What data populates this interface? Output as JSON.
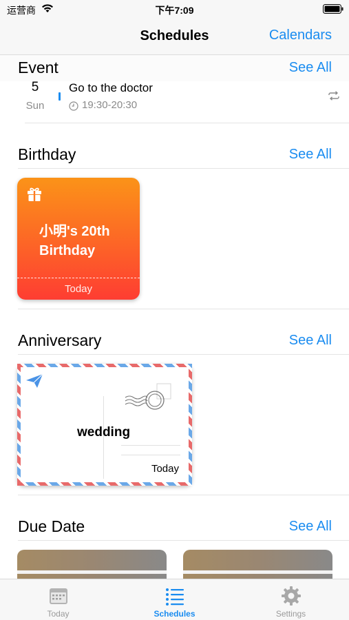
{
  "status_bar": {
    "carrier": "运营商",
    "time": "下午7:09"
  },
  "nav": {
    "title": "Schedules",
    "right_button": "Calendars"
  },
  "sections": {
    "event": {
      "title": "Event",
      "see_all": "See All"
    },
    "birthday": {
      "title": "Birthday",
      "see_all": "See All"
    },
    "anniversary": {
      "title": "Anniversary",
      "see_all": "See All"
    },
    "due_date": {
      "title": "Due Date",
      "see_all": "See All"
    }
  },
  "event_item": {
    "day": "5",
    "weekday": "Sun",
    "title": "Go to the doctor",
    "time": "19:30-20:30"
  },
  "birthday_card": {
    "name": "小明's 20th Birthday",
    "label": "Today"
  },
  "anniversary_card": {
    "title": "wedding",
    "label": "Today"
  },
  "tabs": [
    {
      "label": "Today",
      "icon": "calendar-icon",
      "active": false
    },
    {
      "label": "Schedules",
      "icon": "list-icon",
      "active": true
    },
    {
      "label": "Settings",
      "icon": "gear-icon",
      "active": false
    }
  ],
  "colors": {
    "accent": "#1a8cf0",
    "birthday_top": "#fb9318",
    "birthday_bottom": "#fe3d32"
  }
}
